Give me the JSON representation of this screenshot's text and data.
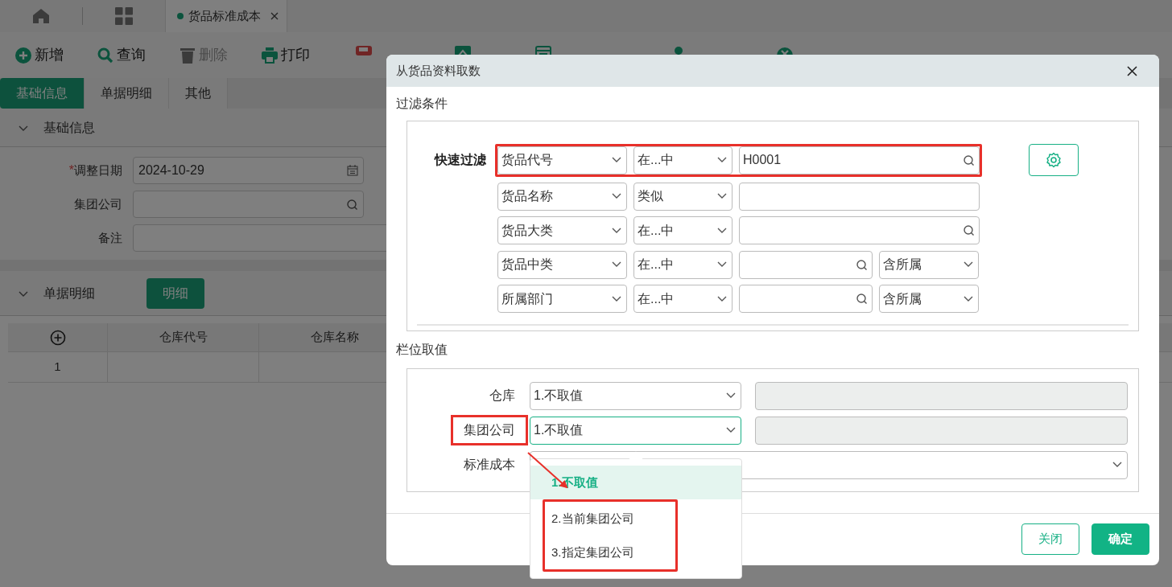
{
  "app_tabs": [
    {
      "label": "货品标准成本",
      "selected": true
    }
  ],
  "toolbar": [
    {
      "label": "新增",
      "disabled": false
    },
    {
      "label": "查询",
      "disabled": false
    },
    {
      "label": "删除",
      "disabled": true
    },
    {
      "label": "打印",
      "disabled": false
    }
  ],
  "section_tabs": [
    {
      "label": "基础信息",
      "selected": true
    },
    {
      "label": "单据明细",
      "selected": false
    },
    {
      "label": "其他",
      "selected": false
    }
  ],
  "basic_info": {
    "title": "基础信息",
    "expanded": true,
    "fields": [
      {
        "label": "调整日期",
        "required_mark": "*",
        "value": "2024-10-29",
        "kind": "date"
      },
      {
        "label": "集团公司",
        "kind": "lookup"
      },
      {
        "label": "备注",
        "kind": "text"
      }
    ]
  },
  "detail": {
    "title": "单据明细",
    "expanded": true,
    "button": "明细",
    "columns": [
      "仓库代号",
      "仓库名称"
    ],
    "rows": [
      {
        "index": "1"
      }
    ]
  },
  "dialog": {
    "title": "从货品资料取数",
    "filter_title": "过滤条件",
    "quick_filter_label": "快速过滤",
    "filters": [
      {
        "field": "货品代号",
        "operator": "在...中",
        "value": "H0001",
        "lookup": true,
        "highlighted": true
      },
      {
        "field": "货品名称",
        "operator": "类似",
        "lookup": false,
        "highlighted": false
      },
      {
        "field": "货品大类",
        "operator": "在...中",
        "lookup": true,
        "highlighted": false
      },
      {
        "field": "货品中类",
        "operator": "在...中",
        "lookup": true,
        "scope": "含所属",
        "highlighted": false
      },
      {
        "field": "所属部门",
        "operator": "在...中",
        "lookup": true,
        "scope": "含所属",
        "highlighted": false
      }
    ],
    "fetch_title": "栏位取值",
    "fetch_fields": [
      {
        "label": "仓库",
        "value": "1.不取值",
        "has_extra": true,
        "focused": false,
        "label_highlighted": false
      },
      {
        "label": "集团公司",
        "value": "1.不取值",
        "has_extra": true,
        "focused": true,
        "label_highlighted": true
      },
      {
        "label": "标准成本",
        "has_extra": false,
        "focused": false,
        "label_highlighted": false
      }
    ],
    "dropdown": {
      "options": [
        {
          "label": "1.不取值",
          "selected": true,
          "highlighted": false
        },
        {
          "label": "2.当前集团公司",
          "selected": false,
          "highlighted": true
        },
        {
          "label": "3.指定集团公司",
          "selected": false,
          "highlighted": true
        }
      ]
    },
    "buttons": [
      {
        "label": "关闭",
        "kind": "secondary"
      },
      {
        "label": "确定",
        "kind": "primary"
      }
    ]
  }
}
